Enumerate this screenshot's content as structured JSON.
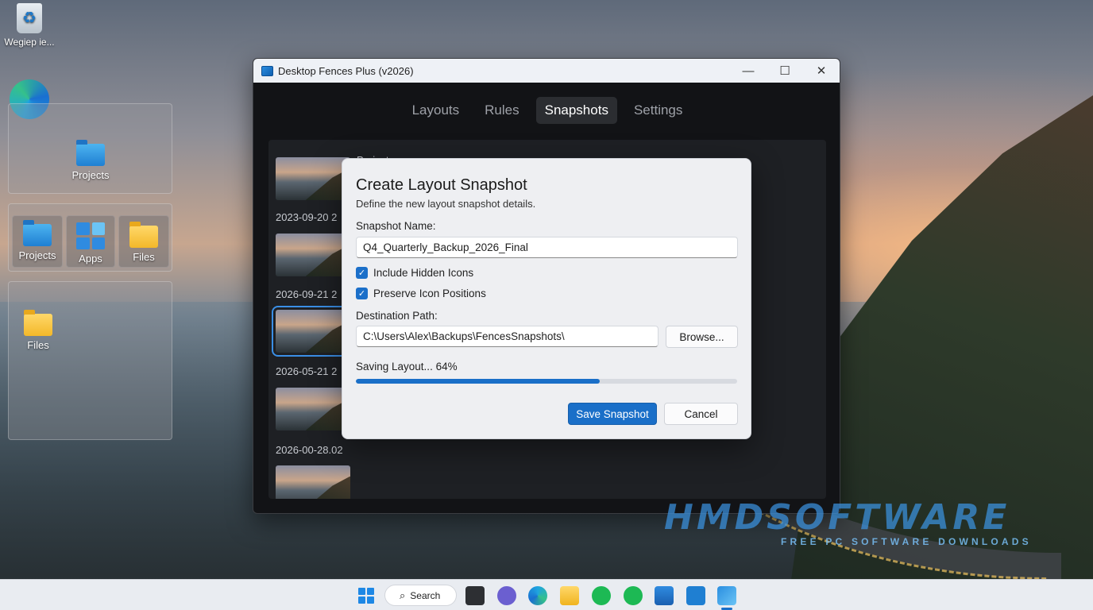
{
  "desktop": {
    "recycle_bin_label": "Wegiep ie...",
    "fence_projects_label": "Projects",
    "fence_tiles": [
      {
        "label": "Projects"
      },
      {
        "label": "Apps"
      },
      {
        "label": "Files"
      }
    ],
    "fence_files_label": "Files"
  },
  "window": {
    "title": "Desktop Fences Plus (v2026)",
    "controls": {
      "minimize": "—",
      "maximize": "☐",
      "close": "✕"
    },
    "tabs": [
      "Layouts",
      "Rules",
      "Snapshots",
      "Settings"
    ],
    "active_tab": "Snapshots",
    "panel_label": "Projects",
    "snapshots": [
      {
        "date": "2023-09-20 2"
      },
      {
        "date": "2026-09-21 2"
      },
      {
        "date": "2026-05-21 2"
      },
      {
        "date": "2026-00-28.02"
      }
    ]
  },
  "dialog": {
    "title": "Create Layout Snapshot",
    "subtitle": "Define the new layout snapshot details.",
    "name_label": "Snapshot Name:",
    "name_value": "Q4_Quarterly_Backup_2026_Final",
    "checkboxes": [
      {
        "label": "Include Hidden Icons",
        "checked": true
      },
      {
        "label": "Preserve Icon Positions",
        "checked": true
      }
    ],
    "path_label": "Destination Path:",
    "path_value": "C:\\Users\\Alex\\Backups\\FencesSnapshots\\",
    "browse_label": "Browse...",
    "progress_text": "Saving Layout... 64%",
    "progress_fraction": 0.64,
    "save_label": "Save Snapshot",
    "cancel_label": "Cancel",
    "accent_color": "#1a6fc8"
  },
  "watermark": {
    "logo_text": "HMDSOFTWARE",
    "tagline": "FREE PC SOFTWARE DOWNLOADS"
  },
  "taskbar": {
    "search_label": "Search",
    "apps": [
      "start-icon",
      "task-view-icon",
      "chat-icon",
      "edge-icon",
      "file-explorer-icon",
      "spotify-icon",
      "spotify-icon",
      "store-icon",
      "mail-icon",
      "fences-icon"
    ]
  }
}
